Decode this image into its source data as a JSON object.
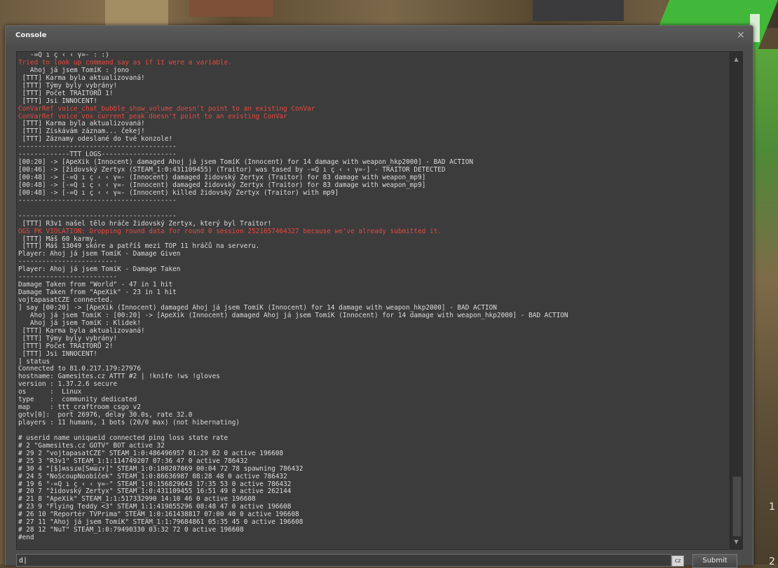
{
  "window": {
    "title": "Console",
    "close_glyph": "×"
  },
  "side_numbers": [
    "1",
    "2"
  ],
  "log_lines": [
    {
      "t": "   -=Q ı ç ‹ ‹ γ=- : :)",
      "err": false
    },
    {
      "t": "Tried to look up command say as if it were a variable.",
      "err": true
    },
    {
      "t": "   Ahoj já jsem TomíK : jono",
      "err": false
    },
    {
      "t": " [TTT] Karma byla aktualizovaná!",
      "err": false
    },
    {
      "t": " [TTT] Týmy byly vybrány!",
      "err": false
    },
    {
      "t": " [TTT] Počet TRAITORŮ 1!",
      "err": false
    },
    {
      "t": " [TTT] Jsi INNOCENT!",
      "err": false
    },
    {
      "t": "ConVarRef voice_chat_bubble_show_volume doesn't point to an existing ConVar",
      "err": true
    },
    {
      "t": "ConVarRef voice_vox_current_peak doesn't point to an existing ConVar",
      "err": true
    },
    {
      "t": " [TTT] Karma byla aktualizovaná!",
      "err": false
    },
    {
      "t": " [TTT] Získávám záznam... čekej!",
      "err": false
    },
    {
      "t": " [TTT] Záznamy odeslané do tvé konzole!",
      "err": false
    },
    {
      "t": "----------------------------------------",
      "err": false
    },
    {
      "t": "-------------TTT LOGS-------------------",
      "err": false
    },
    {
      "t": "[00:20] -> [ApeXik (Innocent) damaged Ahoj já jsem TomíK (Innocent) for 14 damage with weapon_hkp2000] - BAD ACTION",
      "err": false
    },
    {
      "t": "[00:46] -> [židovský Zertyx (STEAM_1:0:431109455) (Traitor) was tased by -=Q ı ç ‹ ‹ γ=-] - TRAITOR DETECTED",
      "err": false
    },
    {
      "t": "[00:48] -> [-=Q ı ç ‹ ‹ γ=- (Innocent) damaged židovský Zertyx (Traitor) for 83 damage with weapon_mp9]",
      "err": false
    },
    {
      "t": "[00:48] -> [-=Q ı ç ‹ ‹ γ=- (Innocent) damaged židovský Zertyx (Traitor) for 83 damage with weapon_mp9]",
      "err": false
    },
    {
      "t": "[00:48] -> [-=Q ı ç ‹ ‹ γ=- (Innocent) killed židovský Zertyx (Traitor) with mp9]",
      "err": false
    },
    {
      "t": "----------------------------------------",
      "err": false
    },
    {
      "t": "",
      "err": false
    },
    {
      "t": "----------------------------------------",
      "err": false
    },
    {
      "t": " [TTT] R3v1 našel tělo hráče židovský Zertyx, který byl Traitor!",
      "err": false
    },
    {
      "t": "OGS PK VIOLATION: Dropping round data for round 0 session 2521657464327 because we've already submitted it.",
      "err": true
    },
    {
      "t": " [TTT] Máš 60 karmy.",
      "err": false
    },
    {
      "t": " [TTT] Máš 13049 skóre a patříš mezi TOP 11 hráčů na serveru.",
      "err": false
    },
    {
      "t": "Player: Ahoj já jsem TomíK - Damage Given",
      "err": false
    },
    {
      "t": "-------------------------",
      "err": false
    },
    {
      "t": "Player: Ahoj já jsem TomíK - Damage Taken",
      "err": false
    },
    {
      "t": "-------------------------",
      "err": false
    },
    {
      "t": "Damage Taken from \"World\" - 47 in 1 hit",
      "err": false
    },
    {
      "t": "Damage Taken from \"ApeXik\" - 23 in 1 hit",
      "err": false
    },
    {
      "t": "vojtapasatCZE connected.",
      "err": false
    },
    {
      "t": "] say [00:20] -> [ApeXik (Innocent) damaged Ahoj já jsem TomíK (Innocent) for 14 damage with weapon_hkp2000] - BAD ACTION",
      "err": false
    },
    {
      "t": "   Ahoj já jsem TomíK : [00:20] -> [ApeXik (Innocent) damaged Ahoj já jsem TomíK (Innocent) for 14 damage with weapon_hkp2000] - BAD ACTION",
      "err": false
    },
    {
      "t": "   Ahoj já jsem TomíK : Klidek!",
      "err": false
    },
    {
      "t": " [TTT] Karma byla aktualizovaná!",
      "err": false
    },
    {
      "t": " [TTT] Týmy byly vybrány!",
      "err": false
    },
    {
      "t": " [TTT] Počet TRAITORŮ 2!",
      "err": false
    },
    {
      "t": " [TTT] Jsi INNOCENT!",
      "err": false
    },
    {
      "t": "] status",
      "err": false
    },
    {
      "t": "Connected to 81.0.217.179:27976",
      "err": false
    },
    {
      "t": "hostname: Gamesites.cz ATTT #2 | !knife !ws !gloves",
      "err": false
    },
    {
      "t": "version : 1.37.2.6 secure",
      "err": false
    },
    {
      "t": "os      :  Linux",
      "err": false
    },
    {
      "t": "type    :  community dedicated",
      "err": false
    },
    {
      "t": "map     : ttt_craftroom_csgo_v2",
      "err": false
    },
    {
      "t": "gotv[0]:  port 26976, delay 30.0s, rate 32.0",
      "err": false
    },
    {
      "t": "players : 11 humans, 1 bots (20/0 max) (not hibernating)",
      "err": false
    },
    {
      "t": "",
      "err": false
    },
    {
      "t": "# userid name uniqueid connected ping loss state rate",
      "err": false
    },
    {
      "t": "# 2 \"Gamesites.cz GOTV\" BOT active 32",
      "err": false
    },
    {
      "t": "# 29 2 \"vojtapasatCZE\" STEAM_1:0:486496957 01:29 82 0 active 196608",
      "err": false
    },
    {
      "t": "# 25 3 \"R3v1\" STEAM_1:1:114749207 07:36 47 0 active 786432",
      "err": false
    },
    {
      "t": "# 30 4 \"[$]ʍѕѕɾʍ[Sʍɯɾʏ]\" STEAM_1:0:100207069 00:04 72 78 spawning 786432",
      "err": false
    },
    {
      "t": "# 24 5 \"NoScoupNoobíček\" STEAM_1:0:86636987 08:28 48 0 active 786432",
      "err": false
    },
    {
      "t": "# 19 6 \"-=Q ı ç ‹ ‹ γ=-\" STEAM_1:0:156829643 17:35 53 0 active 786432",
      "err": false
    },
    {
      "t": "# 20 7 \"židovský Zertyx\" STEAM_1:0:431109455 16:51 49 0 active 262144",
      "err": false
    },
    {
      "t": "# 21 8 \"ApeXik\" STEAM_1:1:517332990 14:10 46 0 active 196608",
      "err": false
    },
    {
      "t": "# 23 9 \"Flying Teddy <3\" STEAM_1:1:419855296 08:48 47 0 active 196608",
      "err": false
    },
    {
      "t": "# 26 10 \"Reportér TVPrima\" STEAM_1:0:161438817 07:00 40 0 active 196608",
      "err": false
    },
    {
      "t": "# 27 11 \"Ahoj já jsem TomíK\" STEAM_1:1:79684861 05:35 45 0 active 196608",
      "err": false
    },
    {
      "t": "# 28 12 \"NuT\" STEAM_1:0:79490330 03:32 72 0 active 196608",
      "err": false
    },
    {
      "t": "#end",
      "err": false
    }
  ],
  "input": {
    "value": "d|",
    "placeholder": ""
  },
  "lang_badge": "cz",
  "submit_label": "Submit",
  "colors": {
    "error_text": "#e8483f",
    "normal_text": "#dcdcdc",
    "panel_bg": "#3c3c3c"
  },
  "icons": {
    "close": "close-icon",
    "scroll_up": "chevron-up-icon",
    "scroll_down": "chevron-down-icon"
  },
  "scroll": {
    "up_glyph": "▲",
    "down_glyph": "▼"
  }
}
